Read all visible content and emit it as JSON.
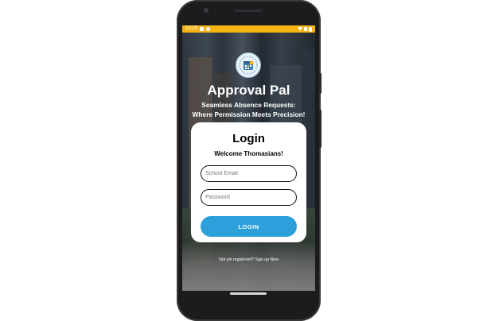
{
  "status_bar": {
    "time": "10:29",
    "background_color": "#f6b313"
  },
  "app": {
    "title": "Approval Pal",
    "tagline_line1": "Seamless Absence Requests:",
    "tagline_line2": "Where Permission Meets Precision!",
    "logo_icon": "calendar-logo-icon"
  },
  "login_card": {
    "title": "Login",
    "subtitle": "Welcome Thomasians!",
    "email_placeholder": "School Email",
    "password_placeholder": "Password",
    "login_button_label": "LOGIN",
    "button_color": "#2d9fdb"
  },
  "footer": {
    "signup_text": "Not yet registered? Sign up Now"
  }
}
